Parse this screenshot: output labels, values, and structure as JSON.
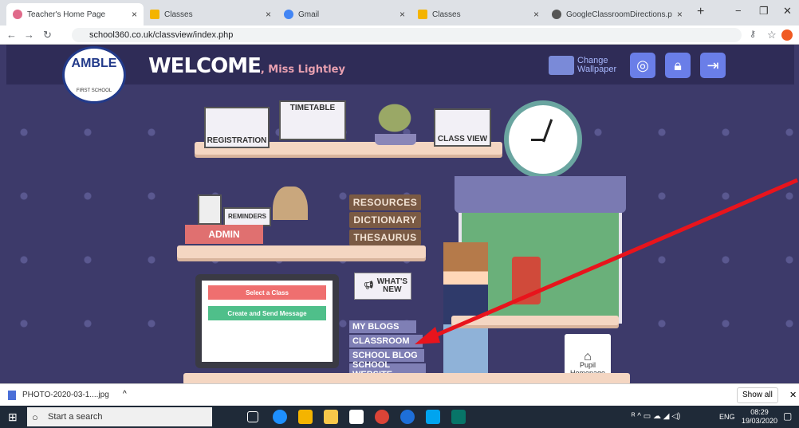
{
  "tabs": [
    {
      "label": "Teacher's Home Page"
    },
    {
      "label": "Classes"
    },
    {
      "label": "Gmail"
    },
    {
      "label": "Classes"
    },
    {
      "label": "GoogleClassroomDirections.p"
    }
  ],
  "address": {
    "url": "school360.co.uk/classview/index.php"
  },
  "page": {
    "logo": {
      "text": "AMBLE",
      "sub": "FIRST SCHOOL"
    },
    "welcome": "WELCOME",
    "teacher": ", Miss Lightley",
    "change_wallpaper": [
      "Change",
      "Wallpaper"
    ],
    "registration": "REGISTRATION",
    "timetable": "TIMETABLE",
    "class_view": "CLASS VIEW",
    "reminders": "REMINDERS",
    "admin": "ADMIN",
    "books": [
      "RESOURCES",
      "DICTIONARY",
      "THESAURUS"
    ],
    "whats_new": [
      "WHAT'S",
      "NEW"
    ],
    "monitor": {
      "select": "Select a Class",
      "create": "Create and Send Message"
    },
    "nav_books": [
      "MY BLOGS",
      "CLASSROOM",
      "SCHOOL BLOG",
      "SCHOOL WEBSITE"
    ],
    "pupil": [
      "Pupil",
      "Homepage"
    ]
  },
  "download": {
    "file": "PHOTO-2020-03-1....jpg",
    "show_all": "Show all"
  },
  "taskbar": {
    "search": "Start a search",
    "lang": "ENG",
    "time": "08:29",
    "date": "19/03/2020"
  },
  "colors": {
    "red_select": "#ef6f6f",
    "green_create": "#4fbf8a",
    "arrow": "#e8141c"
  }
}
